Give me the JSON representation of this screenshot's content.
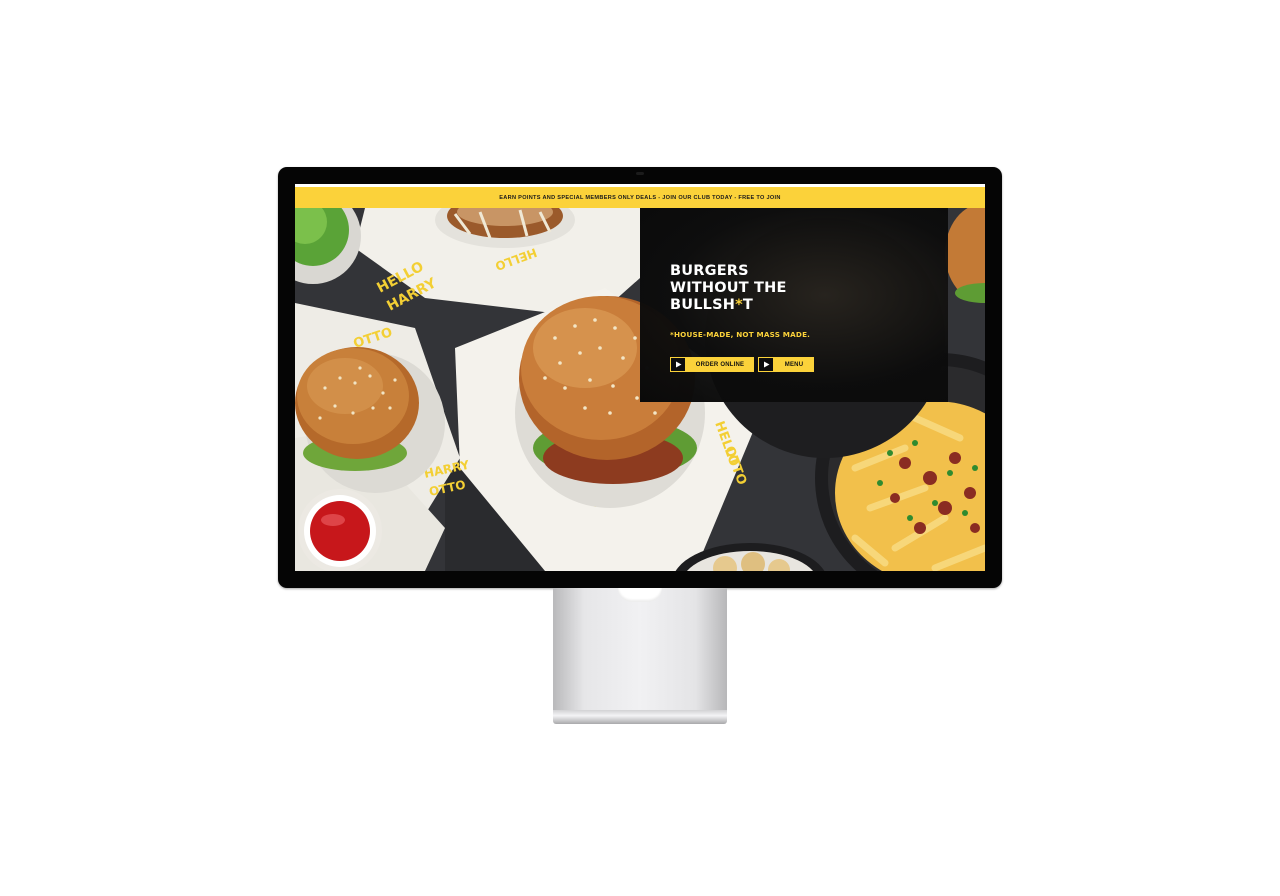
{
  "promo_bar": {
    "text": "EARN POINTS AND SPECIAL MEMBERS ONLY DEALS - JOIN OUR CLUB TODAY - FREE TO JOIN"
  },
  "hero": {
    "title_line_1": "BURGERS",
    "title_line_2": "WITHOUT THE",
    "title_line_3_prefix": "BULLSH",
    "title_line_3_star": "*",
    "title_line_3_suffix": "T",
    "tagline": "*HOUSE-MADE, NOT MASS MADE.",
    "buttons": {
      "order_online": "ORDER ONLINE",
      "menu": "MENU"
    }
  },
  "icons": {
    "play": "play-icon"
  },
  "colors": {
    "brand_yellow": "#fbd23a",
    "panel_black": "#0a0a0a",
    "text_white": "#ffffff"
  }
}
